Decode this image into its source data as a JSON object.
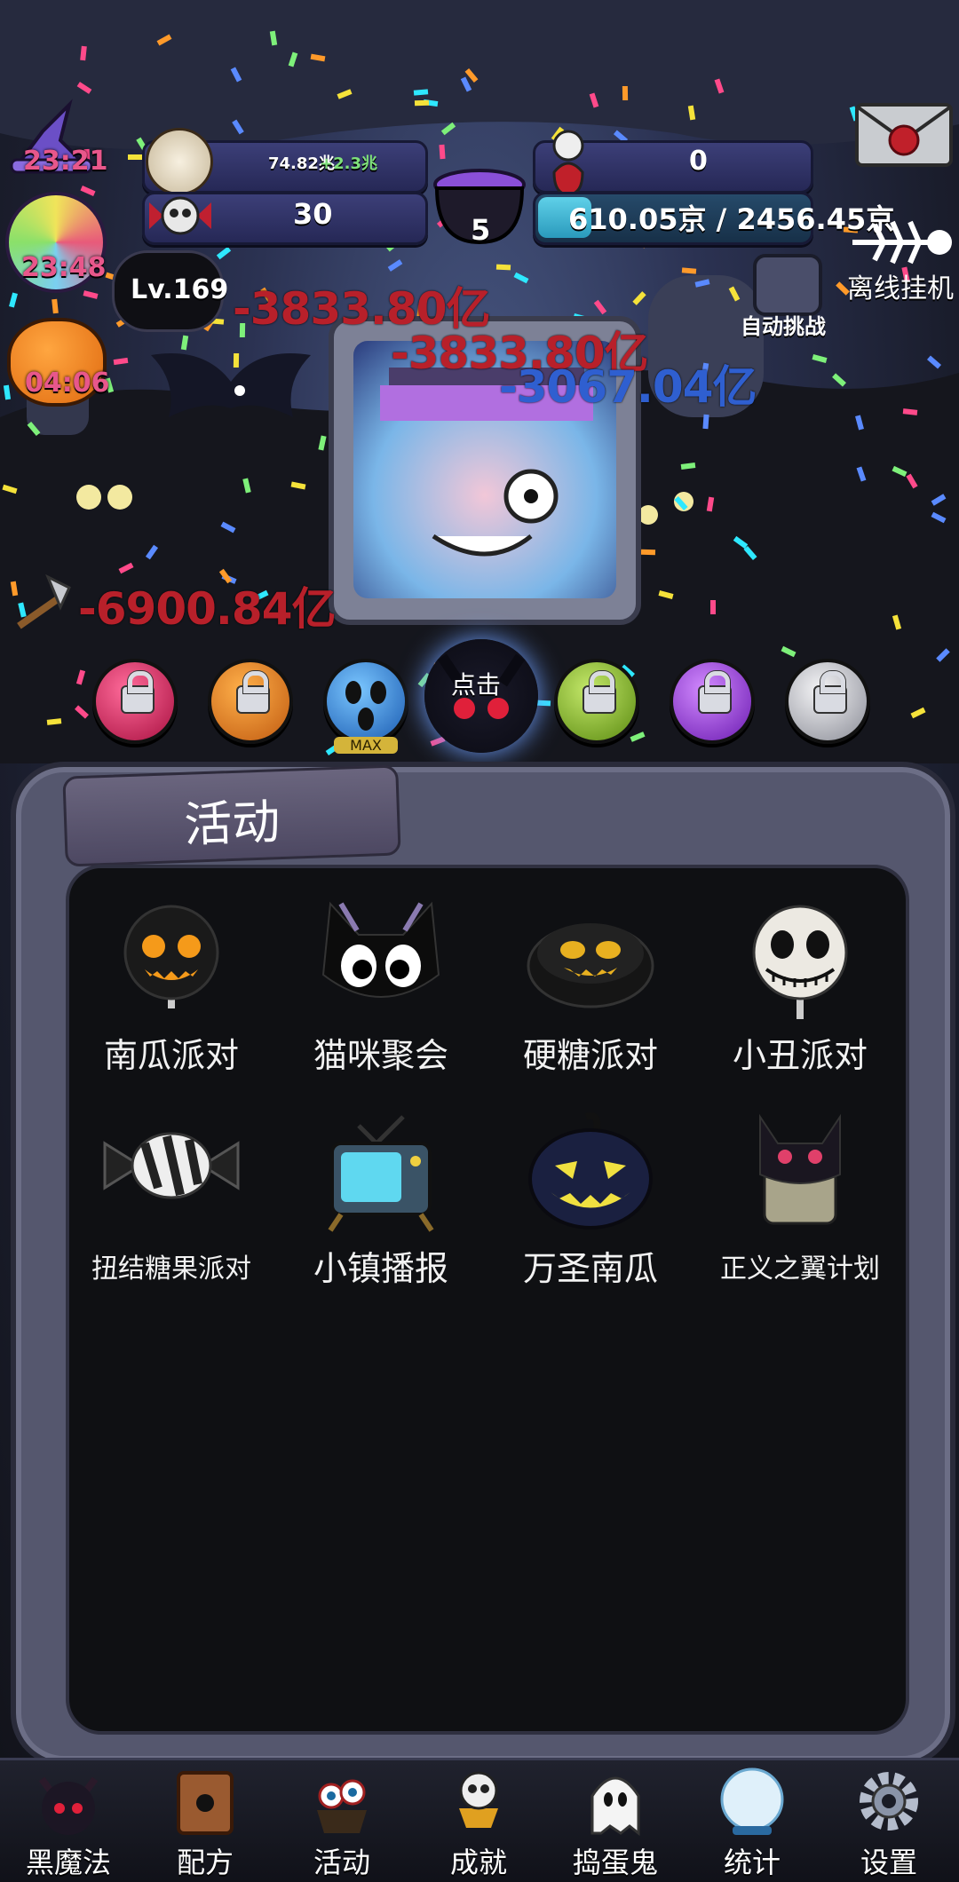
{
  "hud": {
    "coin_value": "74.82兆",
    "coin_rate": "+2.3兆",
    "skull_count": "30",
    "cauldron_count": "5",
    "top_right_value": "0",
    "hp_text": "610.05京 / 2456.45京",
    "level": "Lv.169"
  },
  "timers": {
    "hat": "23:21",
    "candy": "23:48",
    "pumpkin": "04:06"
  },
  "side_buttons": {
    "offline": "离线挂机",
    "auto_challenge": "自动挑战"
  },
  "damage_numbers": [
    "-3833.80亿",
    "-3833.80亿",
    "-3067.04亿",
    "-6900.84亿"
  ],
  "monster_tap": "点击",
  "orb_max": "MAX",
  "panel": {
    "title": "活动",
    "activities": [
      {
        "label": "南瓜派对",
        "icon": "pumpkin-lollipop-icon"
      },
      {
        "label": "猫咪聚会",
        "icon": "black-cat-icon"
      },
      {
        "label": "硬糖派对",
        "icon": "hard-candy-icon"
      },
      {
        "label": "小丑派对",
        "icon": "skull-lollipop-icon"
      },
      {
        "label": "扭结糖果派对",
        "icon": "wrapped-candy-icon"
      },
      {
        "label": "小镇播报",
        "icon": "tv-icon"
      },
      {
        "label": "万圣南瓜",
        "icon": "jack-o-lantern-icon"
      },
      {
        "label": "正义之翼计划",
        "icon": "bat-trophy-icon"
      }
    ]
  },
  "nav": [
    {
      "label": "黑魔法",
      "icon": "devil-icon"
    },
    {
      "label": "配方",
      "icon": "spellbook-icon"
    },
    {
      "label": "活动",
      "icon": "eyeball-cupcake-icon"
    },
    {
      "label": "成就",
      "icon": "skull-trophy-icon"
    },
    {
      "label": "捣蛋鬼",
      "icon": "ghost-icon"
    },
    {
      "label": "统计",
      "icon": "crystal-ball-icon"
    },
    {
      "label": "设置",
      "icon": "gear-icon"
    }
  ],
  "colors": {
    "damage_red": "#b8202a",
    "damage_blue": "#2f5fd0",
    "timer_pink": "#e8578b"
  }
}
